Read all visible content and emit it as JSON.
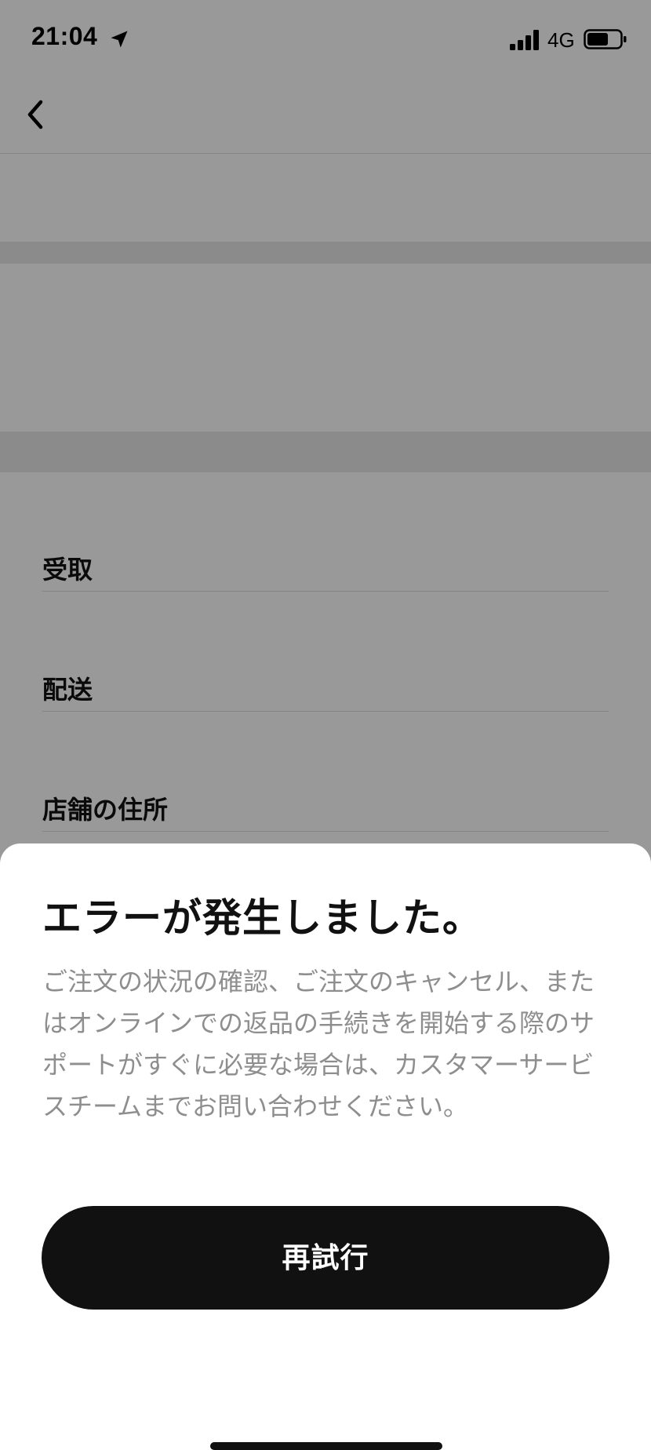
{
  "status_bar": {
    "time": "21:04",
    "network": "4G",
    "icons": [
      "location-arrow-icon",
      "signal-bars-icon",
      "battery-icon"
    ]
  },
  "nav": {
    "back_icon": "chevron-left-icon"
  },
  "options": {
    "pickup_label": "受取",
    "delivery_label": "配送",
    "store_address_label": "店舗の住所"
  },
  "error_sheet": {
    "title": "エラーが発生しました。",
    "message": "ご注文の状況の確認、ご注文のキャンセル、またはオンラインでの返品の手続きを開始する際のサポートがすぐに必要な場合は、カスタマーサービスチームまでお問い合わせください。",
    "retry_label": "再試行"
  },
  "colors": {
    "overlay": "rgba(0,0,0,0.4)",
    "button_bg": "#111111",
    "message_text": "#8e8e8e"
  }
}
